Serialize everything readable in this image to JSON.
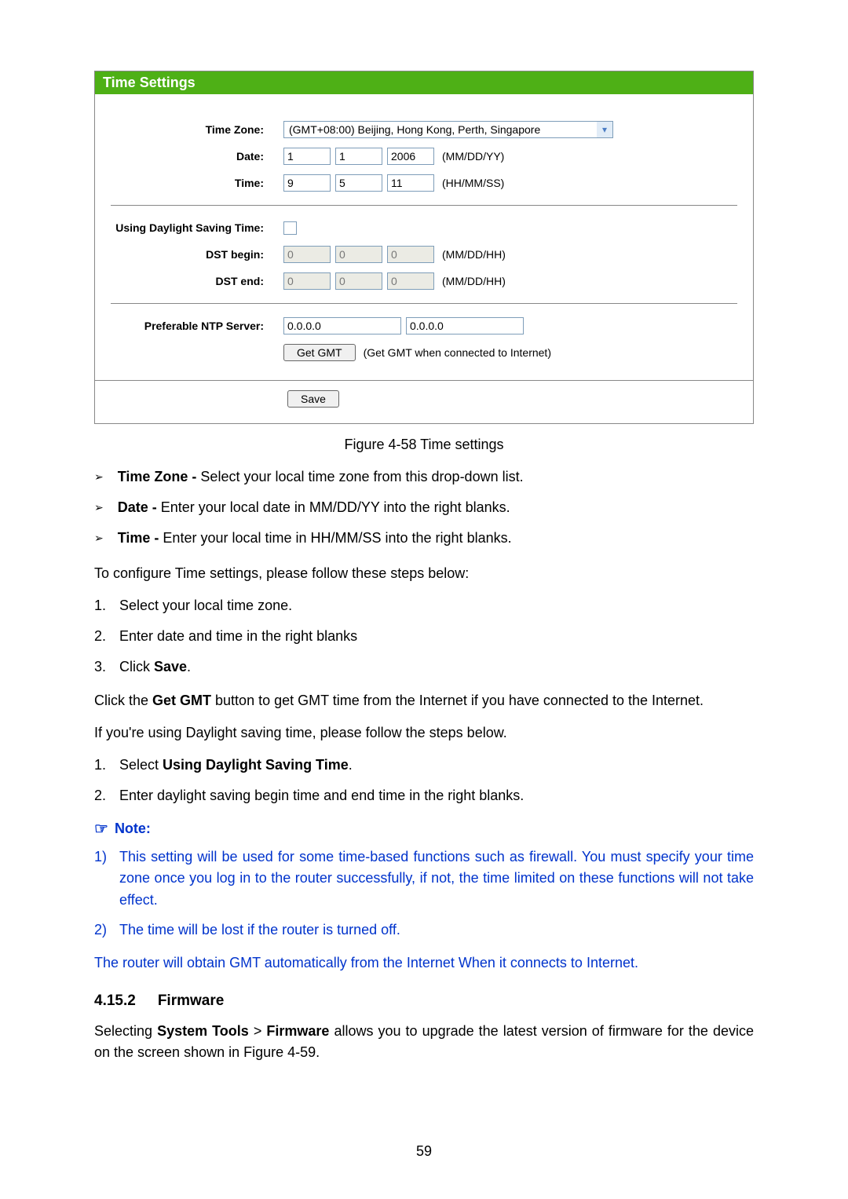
{
  "panel": {
    "title": "Time Settings",
    "labels": {
      "timezone": "Time Zone:",
      "date": "Date:",
      "time": "Time:",
      "dst_using": "Using Daylight Saving Time:",
      "dst_begin": "DST begin:",
      "dst_end": "DST end:",
      "ntp": "Preferable NTP Server:"
    },
    "timezone_value": "(GMT+08:00) Beijing, Hong Kong, Perth, Singapore",
    "date": {
      "mm": "1",
      "dd": "1",
      "yy": "2006",
      "hint": "(MM/DD/YY)"
    },
    "time": {
      "hh": "9",
      "mm": "5",
      "ss": "11",
      "hint": "(HH/MM/SS)"
    },
    "dst_begin": {
      "a": "0",
      "b": "0",
      "c": "0",
      "hint": "(MM/DD/HH)"
    },
    "dst_end": {
      "a": "0",
      "b": "0",
      "c": "0",
      "hint": "(MM/DD/HH)"
    },
    "ntp1": "0.0.0.0",
    "ntp2": "0.0.0.0",
    "get_gmt_btn": "Get GMT",
    "get_gmt_hint": "(Get GMT when connected to Internet)",
    "save_btn": "Save"
  },
  "caption": "Figure 4-58 Time settings",
  "bullets": [
    {
      "term": "Time Zone - ",
      "desc": "Select your local time zone from this drop-down list."
    },
    {
      "term": "Date - ",
      "desc": "Enter your local date in MM/DD/YY into the right blanks."
    },
    {
      "term": "Time - ",
      "desc": "Enter your local time in HH/MM/SS into the right blanks."
    }
  ],
  "para_configure": "To configure Time settings, please follow these steps below:",
  "steps1": [
    "Select your local time zone.",
    "Enter date and time in the right blanks"
  ],
  "step1_3_prefix": "Click ",
  "step1_3_bold": "Save",
  "step1_3_suffix": ".",
  "para_gmt_prefix": "Click the ",
  "para_gmt_bold": "Get GMT",
  "para_gmt_suffix": " button to get GMT time from the Internet if you have connected to the Internet.",
  "para_dst_intro": "If you're using Daylight saving time, please follow the steps below.",
  "steps2_1_prefix": "Select ",
  "steps2_1_bold": "Using Daylight Saving Time",
  "steps2_1_suffix": ".",
  "steps2_2": "Enter daylight saving begin time and end time in the right blanks.",
  "note_label": "Note:",
  "notes": [
    "This setting will be used for some time-based functions such as firewall. You must specify your time zone once you log in to the router successfully, if not, the time limited on these functions will not take effect.",
    "The time will be lost if the router is turned off."
  ],
  "note_para": "The router will obtain GMT automatically from the Internet When it connects to Internet.",
  "section": {
    "num": "4.15.2",
    "title": "Firmware"
  },
  "firmware_para_p1": "Selecting ",
  "firmware_bold1": "System Tools",
  "firmware_sep": " > ",
  "firmware_bold2": "Firmware",
  "firmware_para_p2": " allows you to upgrade the latest version of firmware for the device on the screen shown in Figure 4-59.",
  "page_number": "59"
}
